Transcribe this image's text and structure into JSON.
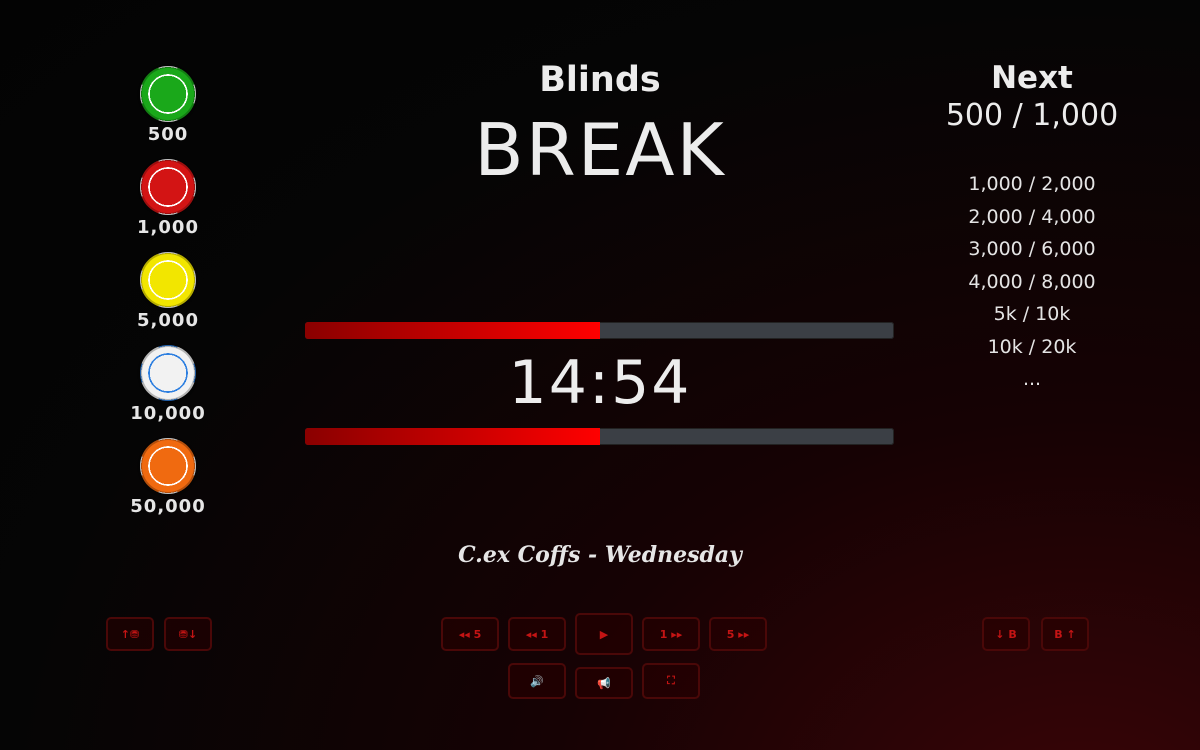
{
  "chips": [
    {
      "value": "500",
      "color": "#1aa81a"
    },
    {
      "value": "1,000",
      "color": "#d31414"
    },
    {
      "value": "5,000",
      "color": "#f2e600"
    },
    {
      "value": "10,000",
      "color": "#f2f2f2",
      "accent": "#2d7fe0"
    },
    {
      "value": "50,000",
      "color": "#f06a10"
    }
  ],
  "blinds": {
    "title": "Blinds",
    "current": "BREAK"
  },
  "timer": {
    "time": "14:54",
    "progress": 0.5
  },
  "next": {
    "title": "Next",
    "value": "500 / 1,000",
    "upcoming": [
      "1,000 / 2,000",
      "2,000 / 4,000",
      "3,000 / 6,000",
      "4,000 / 8,000",
      "5k / 10k",
      "10k / 20k",
      "..."
    ]
  },
  "event": {
    "name": "C.ex Coffs - Wednesday"
  },
  "controls": {
    "left": [
      {
        "label": "↑⛃",
        "icon": "chips-up-icon"
      },
      {
        "label": "⛃↓",
        "icon": "chips-down-icon"
      }
    ],
    "center": [
      {
        "label": "◂◂ 5",
        "icon": "rewind-icon"
      },
      {
        "label": "◂◂ 1",
        "icon": "rewind-icon"
      },
      {
        "label": "▶",
        "icon": "play-icon"
      },
      {
        "label": "1 ▸▸",
        "icon": "fast-forward-icon"
      },
      {
        "label": "5 ▸▸",
        "icon": "fast-forward-icon"
      }
    ],
    "bottom": [
      {
        "label": "🔊",
        "icon": "speaker-icon"
      },
      {
        "label": "📢",
        "icon": "megaphone-icon"
      },
      {
        "label": "⛶",
        "icon": "fullscreen-icon"
      }
    ],
    "right": [
      {
        "label": "↓ B",
        "icon": "arrow-down-icon"
      },
      {
        "label": "B ↑",
        "icon": "arrow-up-icon"
      }
    ]
  },
  "colors": {
    "accent": "#ff0000",
    "bar_bg": "#3b3f45",
    "button_text": "#c41414"
  }
}
